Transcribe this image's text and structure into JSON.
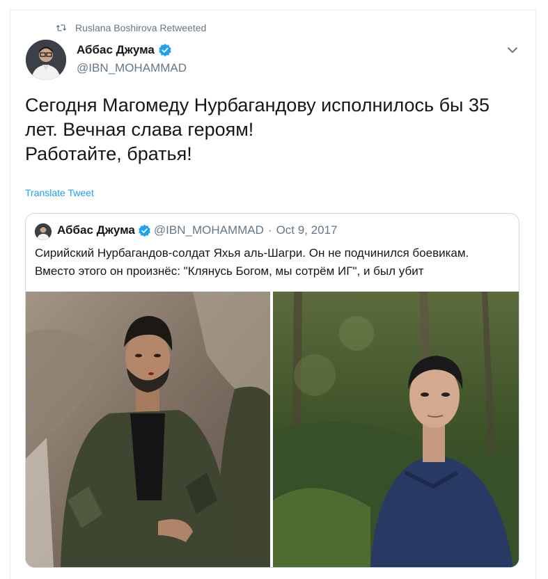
{
  "retweet": {
    "label": "Ruslana Boshirova Retweeted",
    "icon": "retweet-icon"
  },
  "author": {
    "name": "Аббас Джума",
    "handle": "@IBN_MOHAMMAD",
    "verified": true
  },
  "tweet": {
    "text": "Сегодня Магомеду Нурбагандову исполнилось бы 35\nлет. Вечная слава героям!\nРаботайте, братья!"
  },
  "translate_label": "Translate Tweet",
  "quote": {
    "name": "Аббас Джума",
    "handle": "@IBN_MOHAMMAD",
    "separator": "·",
    "date": "Oct 9, 2017",
    "text": "Сирийский Нурбагандов-солдат Яхья аль-Шагри. Он не подчинился боевикам.\nВместо этого он произнёс: \"Клянусь Богом, мы сотрём ИГ\", и был убит"
  },
  "colors": {
    "accent": "#1da1f2",
    "secondary_text": "#657786",
    "border": "#ccd6dd"
  }
}
